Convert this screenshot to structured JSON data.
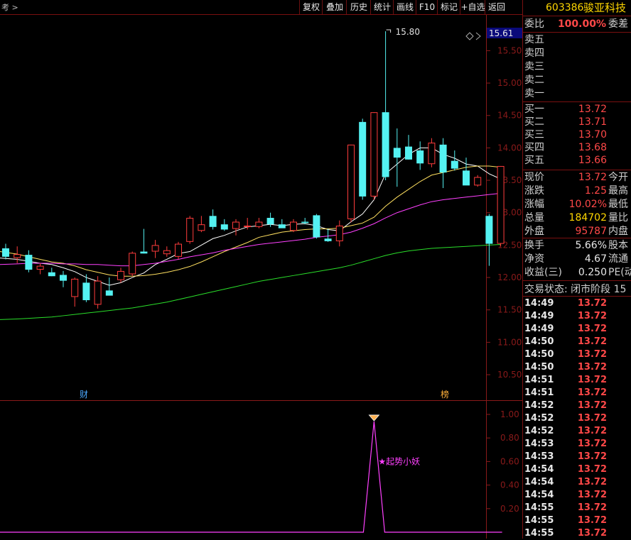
{
  "toolbar": {
    "left_label": "考 >",
    "buttons": [
      "复权",
      "叠加",
      "历史",
      "统计",
      "画线",
      "F10",
      "标记",
      "+自选",
      "返回"
    ],
    "price_marker": "15.61"
  },
  "colors": {
    "up": "#ff3c3c",
    "down": "#54f2f2",
    "ma5": "#ffffff",
    "ma10": "#ffe060",
    "ma20": "#ff40ff",
    "ma60": "#2adf2a",
    "indicator": "#ff40ff",
    "axis": "#8a1a1a"
  },
  "chart_data": [
    {
      "type": "candlestick",
      "y_ticks": [
        "15.50",
        "15.00",
        "14.50",
        "14.00",
        "13.50",
        "13.00",
        "12.50",
        "12.00",
        "11.50",
        "11.00",
        "10.50"
      ],
      "ylim": [
        10.2,
        15.92
      ],
      "high_annotation": "15.80",
      "markers": [
        "财",
        "榜"
      ],
      "ohlc": [
        [
          12.45,
          12.52,
          12.28,
          12.32
        ],
        [
          12.3,
          12.48,
          12.22,
          12.36
        ],
        [
          12.35,
          12.42,
          12.08,
          12.12
        ],
        [
          12.12,
          12.22,
          12.05,
          12.18
        ],
        [
          12.08,
          12.15,
          12.02,
          12.02
        ],
        [
          12.04,
          12.1,
          11.85,
          11.95
        ],
        [
          11.7,
          12.0,
          11.55,
          11.98
        ],
        [
          11.92,
          12.05,
          11.62,
          11.65
        ],
        [
          11.58,
          12.02,
          11.52,
          11.95
        ],
        [
          11.8,
          12.0,
          11.75,
          11.72
        ],
        [
          11.96,
          12.15,
          11.92,
          12.1
        ],
        [
          12.05,
          12.4,
          12.02,
          12.38
        ],
        [
          12.4,
          12.75,
          12.37,
          12.37
        ],
        [
          12.4,
          12.58,
          12.3,
          12.5
        ],
        [
          12.36,
          12.48,
          12.32,
          12.42
        ],
        [
          12.32,
          12.55,
          12.28,
          12.52
        ],
        [
          12.55,
          12.95,
          12.52,
          12.92
        ],
        [
          12.72,
          12.95,
          12.7,
          12.82
        ],
        [
          12.95,
          13.05,
          12.74,
          12.78
        ],
        [
          12.82,
          12.9,
          12.72,
          12.74
        ],
        [
          12.75,
          12.9,
          12.65,
          12.86
        ],
        [
          12.78,
          12.92,
          12.74,
          12.8
        ],
        [
          12.78,
          12.92,
          12.76,
          12.86
        ],
        [
          12.92,
          13.0,
          12.78,
          12.82
        ],
        [
          12.82,
          12.9,
          12.78,
          12.76
        ],
        [
          12.72,
          12.9,
          12.7,
          12.86
        ],
        [
          12.86,
          12.92,
          12.82,
          12.84
        ],
        [
          12.96,
          12.98,
          12.6,
          12.62
        ],
        [
          12.6,
          12.75,
          12.55,
          12.56
        ],
        [
          12.56,
          12.88,
          12.48,
          12.8
        ],
        [
          12.9,
          14.05,
          12.85,
          14.05
        ],
        [
          14.4,
          14.45,
          13.2,
          13.25
        ],
        [
          13.25,
          14.55,
          13.2,
          14.55
        ],
        [
          14.55,
          15.8,
          13.5,
          13.55
        ],
        [
          14.0,
          14.3,
          13.4,
          13.85
        ],
        [
          14.02,
          14.2,
          13.82,
          13.82
        ],
        [
          13.96,
          14.1,
          13.66,
          13.76
        ],
        [
          13.75,
          14.15,
          13.7,
          14.08
        ],
        [
          14.05,
          14.15,
          13.38,
          13.62
        ],
        [
          13.8,
          13.96,
          13.65,
          13.68
        ],
        [
          13.65,
          13.85,
          13.5,
          13.42
        ],
        [
          13.42,
          13.58,
          13.4,
          13.55
        ],
        [
          12.95,
          12.98,
          12.18,
          12.52
        ],
        [
          12.52,
          13.72,
          12.48,
          13.72
        ]
      ],
      "ma_series": [
        {
          "name": "MA5",
          "values": [
            12.3,
            12.28,
            12.25,
            12.22,
            12.2,
            12.15,
            12.09,
            12.0,
            11.94,
            11.88,
            11.92,
            12.0,
            12.07,
            12.2,
            12.28,
            12.37,
            12.4,
            12.5,
            12.6,
            12.65,
            12.72,
            12.78,
            12.8,
            12.82,
            12.8,
            12.82,
            12.83,
            12.8,
            12.74,
            12.72,
            12.86,
            12.98,
            13.2,
            13.6,
            13.75,
            13.9,
            14.0,
            14.0,
            13.9,
            13.84,
            13.75,
            13.72,
            13.6,
            13.52
          ]
        },
        {
          "name": "MA10",
          "values": [
            12.4,
            12.36,
            12.32,
            12.28,
            12.24,
            12.22,
            12.18,
            12.12,
            12.08,
            12.04,
            12.02,
            12.02,
            12.03,
            12.05,
            12.08,
            12.12,
            12.17,
            12.24,
            12.32,
            12.4,
            12.47,
            12.54,
            12.62,
            12.66,
            12.7,
            12.72,
            12.74,
            12.75,
            12.75,
            12.76,
            12.8,
            12.84,
            12.93,
            13.1,
            13.24,
            13.36,
            13.48,
            13.58,
            13.62,
            13.66,
            13.7,
            13.72,
            13.72,
            13.7
          ]
        },
        {
          "name": "MA20",
          "values": [
            12.2,
            12.21,
            12.22,
            12.22,
            12.22,
            12.21,
            12.21,
            12.2,
            12.2,
            12.19,
            12.18,
            12.18,
            12.2,
            12.22,
            12.25,
            12.28,
            12.32,
            12.35,
            12.38,
            12.42,
            12.45,
            12.48,
            12.51,
            12.53,
            12.55,
            12.57,
            12.59,
            12.62,
            12.64,
            12.66,
            12.7,
            12.76,
            12.83,
            12.92,
            13.0,
            13.06,
            13.12,
            13.17,
            13.2,
            13.22,
            13.24,
            13.26,
            13.28,
            13.3
          ]
        },
        {
          "name": "MA60",
          "values": [
            11.35,
            11.36,
            11.37,
            11.38,
            11.39,
            11.41,
            11.43,
            11.45,
            11.47,
            11.49,
            11.51,
            11.53,
            11.56,
            11.59,
            11.62,
            11.66,
            11.7,
            11.74,
            11.78,
            11.82,
            11.86,
            11.9,
            11.94,
            11.97,
            12.0,
            12.03,
            12.06,
            12.09,
            12.12,
            12.15,
            12.19,
            12.24,
            12.29,
            12.34,
            12.38,
            12.41,
            12.43,
            12.45,
            12.46,
            12.47,
            12.48,
            12.49,
            12.5,
            12.51
          ]
        }
      ]
    },
    {
      "type": "line",
      "name": "起势小妖",
      "y_ticks": [
        "1.00",
        "0.80",
        "0.60",
        "0.40",
        "0.20"
      ],
      "ylim": [
        0,
        1.1
      ],
      "values": [
        0,
        0,
        0,
        0,
        0,
        0,
        0,
        0,
        0,
        0,
        0,
        0,
        0,
        0,
        0,
        0,
        0,
        0,
        0,
        0,
        0,
        0,
        0,
        0,
        0,
        0,
        0,
        0,
        0,
        0,
        0,
        0,
        1,
        0,
        0,
        0,
        0,
        0,
        0,
        0,
        0,
        0,
        0,
        0
      ]
    }
  ],
  "panel": {
    "stock": {
      "code": "603386",
      "name": "骏亚科技"
    },
    "wb": {
      "label": "委比",
      "value": "100.00%",
      "label2": "委差"
    },
    "sells": [
      "卖五",
      "卖四",
      "卖三",
      "卖二",
      "卖一"
    ],
    "buys": [
      {
        "label": "买一",
        "price": "13.72"
      },
      {
        "label": "买二",
        "price": "13.71"
      },
      {
        "label": "买三",
        "price": "13.70"
      },
      {
        "label": "买四",
        "price": "13.68"
      },
      {
        "label": "买五",
        "price": "13.66"
      }
    ],
    "quote": [
      {
        "label": "现价",
        "value": "13.72",
        "label2": "今开"
      },
      {
        "label": "涨跌",
        "value": "1.25",
        "label2": "最高"
      },
      {
        "label": "涨幅",
        "value": "10.02%",
        "label2": "最低"
      },
      {
        "label": "总量",
        "value": "184702",
        "label2": "量比"
      },
      {
        "label": "外盘",
        "value": "95787",
        "label2": "内盘"
      }
    ],
    "quote2": [
      {
        "label": "换手",
        "value": "5.66%",
        "label2": "股本"
      },
      {
        "label": "净资",
        "value": "4.67",
        "label2": "流通"
      },
      {
        "label": "收益(三)",
        "value": "0.250",
        "label2": "PE(动"
      }
    ],
    "status": "交易状态: 闭市阶段 15",
    "ticks": [
      {
        "t": "14:49",
        "p": "13.72"
      },
      {
        "t": "14:49",
        "p": "13.72"
      },
      {
        "t": "14:49",
        "p": "13.72"
      },
      {
        "t": "14:50",
        "p": "13.72"
      },
      {
        "t": "14:50",
        "p": "13.72"
      },
      {
        "t": "14:50",
        "p": "13.72"
      },
      {
        "t": "14:51",
        "p": "13.72"
      },
      {
        "t": "14:51",
        "p": "13.72"
      },
      {
        "t": "14:52",
        "p": "13.72"
      },
      {
        "t": "14:52",
        "p": "13.72"
      },
      {
        "t": "14:52",
        "p": "13.72"
      },
      {
        "t": "14:53",
        "p": "13.72"
      },
      {
        "t": "14:53",
        "p": "13.72"
      },
      {
        "t": "14:54",
        "p": "13.72"
      },
      {
        "t": "14:54",
        "p": "13.72"
      },
      {
        "t": "14:54",
        "p": "13.72"
      },
      {
        "t": "14:55",
        "p": "13.72"
      },
      {
        "t": "14:55",
        "p": "13.72"
      },
      {
        "t": "14:55",
        "p": "13.72"
      }
    ]
  }
}
